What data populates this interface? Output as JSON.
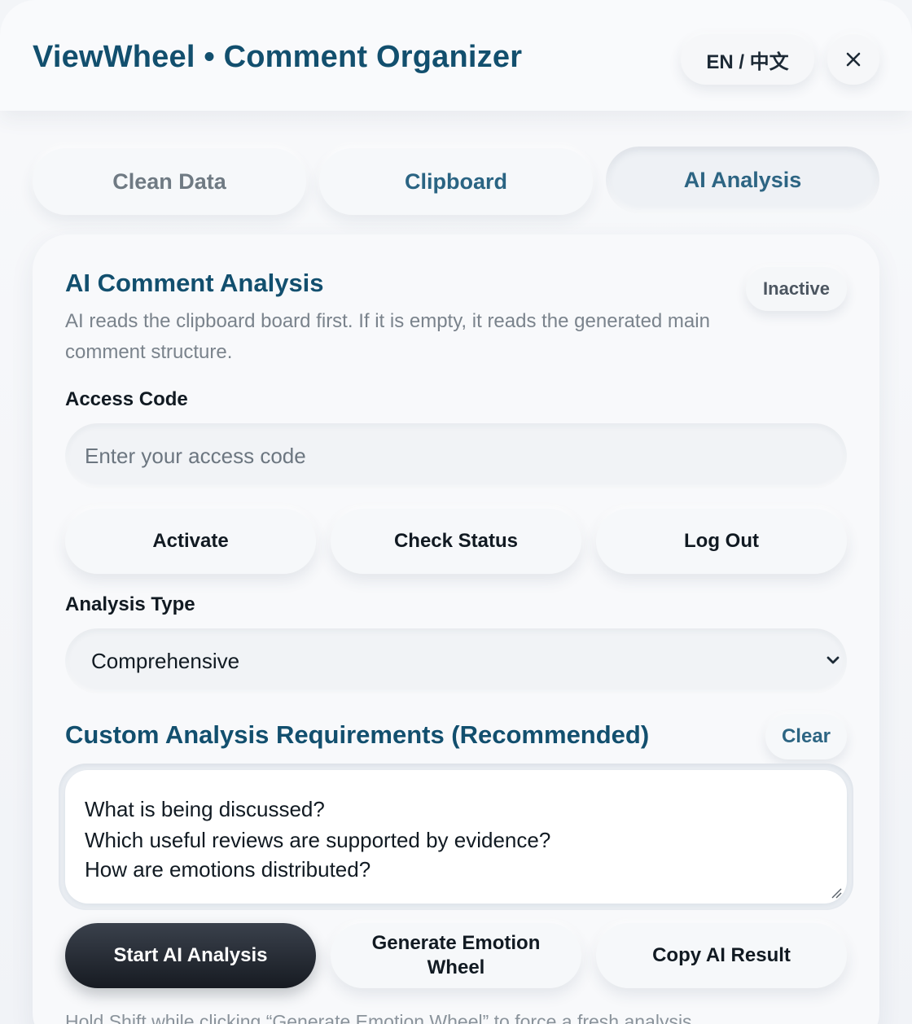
{
  "header": {
    "title": "ViewWheel • Comment Organizer",
    "lang_toggle": "EN / 中文",
    "close_icon": "close-icon"
  },
  "tabs": [
    {
      "label": "Clean Data",
      "active": false
    },
    {
      "label": "Clipboard",
      "active": false
    },
    {
      "label": "AI Analysis",
      "active": true
    }
  ],
  "ai_panel": {
    "title": "AI Comment Analysis",
    "status": "Inactive",
    "description": "AI reads the clipboard board first. If it is empty, it reads the generated main comment structure.",
    "access_code": {
      "label": "Access Code",
      "placeholder": "Enter your access code",
      "value": ""
    },
    "auth_buttons": {
      "activate": "Activate",
      "check_status": "Check Status",
      "log_out": "Log Out"
    },
    "analysis_type": {
      "label": "Analysis Type",
      "selected": "Comprehensive",
      "chevron_icon": "chevron-down-icon"
    },
    "custom_requirements": {
      "title": "Custom Analysis Requirements (Recommended)",
      "clear_label": "Clear",
      "lines": [
        "What is being discussed?",
        "Which useful reviews are supported by evidence?",
        "How are emotions distributed?"
      ]
    },
    "action_buttons": {
      "start": "Start AI Analysis",
      "generate": "Generate Emotion Wheel",
      "copy": "Copy AI Result"
    },
    "footnote": "Hold Shift while clicking “Generate Emotion Wheel” to force a fresh analysis."
  },
  "colors": {
    "accent": "#124f6e",
    "primary_button": "#1f242c",
    "background": "#f3f5f8"
  }
}
